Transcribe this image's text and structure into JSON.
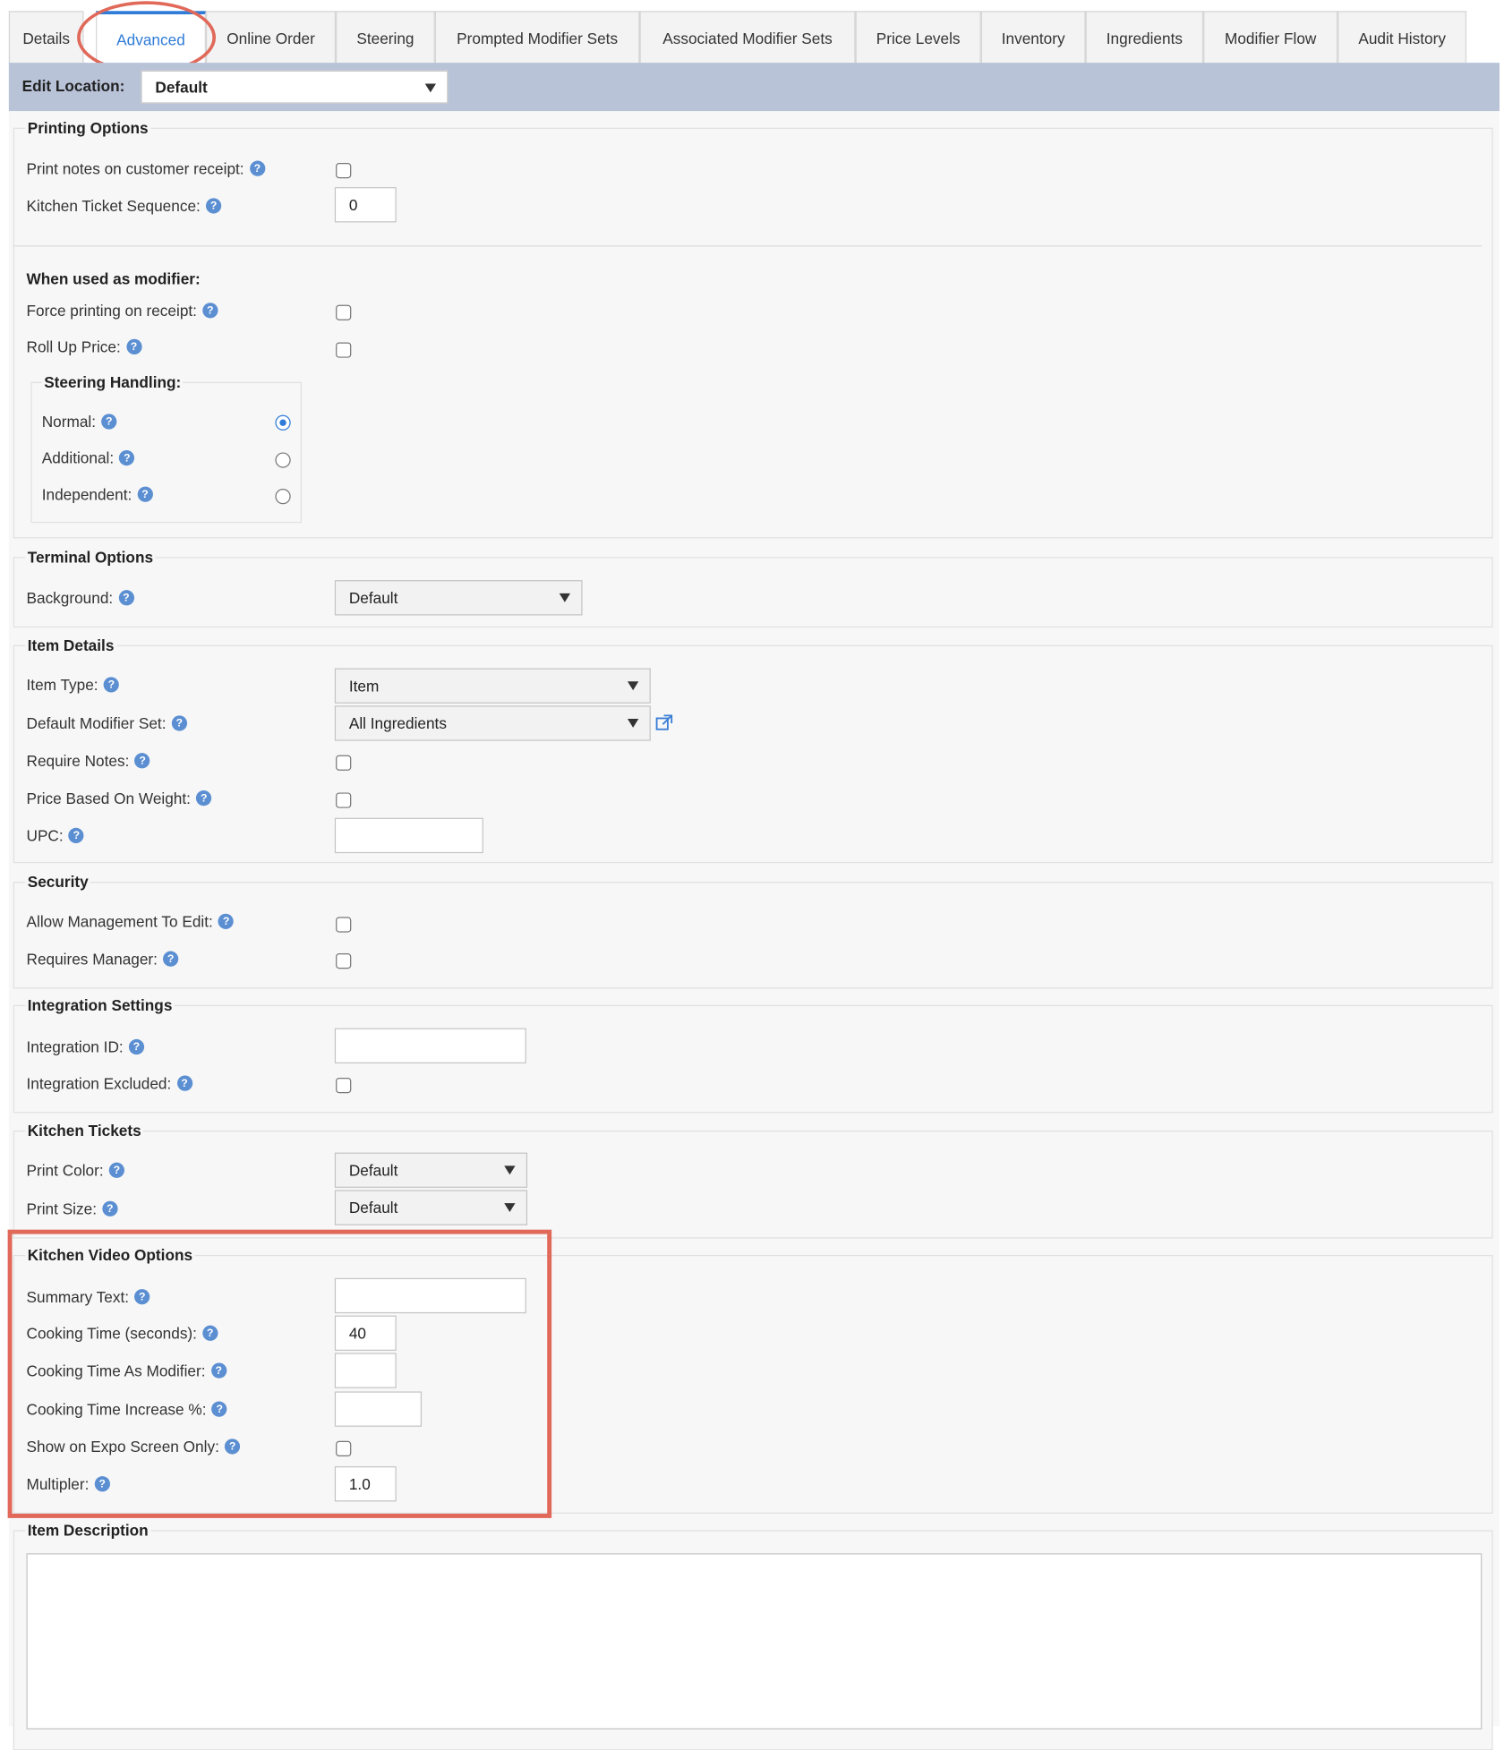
{
  "tabs": [
    {
      "label": "Details",
      "active": false
    },
    {
      "label": "Advanced",
      "active": true
    },
    {
      "label": "Online Order",
      "active": false
    },
    {
      "label": "Steering",
      "active": false
    },
    {
      "label": "Prompted Modifier Sets",
      "active": false
    },
    {
      "label": "Associated Modifier Sets",
      "active": false
    },
    {
      "label": "Price Levels",
      "active": false
    },
    {
      "label": "Inventory",
      "active": false
    },
    {
      "label": "Ingredients",
      "active": false
    },
    {
      "label": "Modifier Flow",
      "active": false
    },
    {
      "label": "Audit History",
      "active": false
    }
  ],
  "location": {
    "label": "Edit Location:",
    "value": "Default"
  },
  "printing": {
    "title": "Printing Options",
    "print_notes_label": "Print notes on customer receipt:",
    "print_notes_checked": false,
    "kitchen_seq_label": "Kitchen Ticket Sequence:",
    "kitchen_seq_value": "0",
    "modifier_heading": "When used as modifier:",
    "force_print_label": "Force printing on receipt:",
    "force_print_checked": false,
    "rollup_label": "Roll Up Price:",
    "rollup_checked": false,
    "steering_title": "Steering Handling:",
    "steering_normal": "Normal:",
    "steering_additional": "Additional:",
    "steering_independent": "Independent:",
    "steering_selected": "Normal"
  },
  "terminal": {
    "title": "Terminal Options",
    "background_label": "Background:",
    "background_value": "Default"
  },
  "item_details": {
    "title": "Item Details",
    "item_type_label": "Item Type:",
    "item_type_value": "Item",
    "default_modset_label": "Default Modifier Set:",
    "default_modset_value": "All Ingredients",
    "require_notes_label": "Require Notes:",
    "require_notes_checked": false,
    "weight_label": "Price Based On Weight:",
    "weight_checked": false,
    "upc_label": "UPC:",
    "upc_value": ""
  },
  "security": {
    "title": "Security",
    "allow_mgmt_label": "Allow Management To Edit:",
    "allow_mgmt_checked": false,
    "req_manager_label": "Requires Manager:",
    "req_manager_checked": false
  },
  "integration": {
    "title": "Integration Settings",
    "id_label": "Integration ID:",
    "id_value": "",
    "excluded_label": "Integration Excluded:",
    "excluded_checked": false
  },
  "kitchen_tickets": {
    "title": "Kitchen Tickets",
    "color_label": "Print Color:",
    "color_value": "Default",
    "size_label": "Print Size:",
    "size_value": "Default"
  },
  "kitchen_video": {
    "title": "Kitchen Video Options",
    "summary_label": "Summary Text:",
    "summary_value": "",
    "cooking_time_label": "Cooking Time (seconds):",
    "cooking_time_value": "40",
    "cooking_mod_label": "Cooking Time As Modifier:",
    "cooking_mod_value": "",
    "increase_label": "Cooking Time Increase %:",
    "increase_value": "",
    "expo_label": "Show on Expo Screen Only:",
    "expo_checked": false,
    "multiplier_label": "Multipler:",
    "multiplier_value": "1.0"
  },
  "description": {
    "title": "Item Description",
    "value": ""
  },
  "colors": {
    "accent": "#2f7bd8",
    "annotation": "#e0695a",
    "location_bar": "#b9c3d8",
    "help_icon": "#5b8fd2"
  }
}
